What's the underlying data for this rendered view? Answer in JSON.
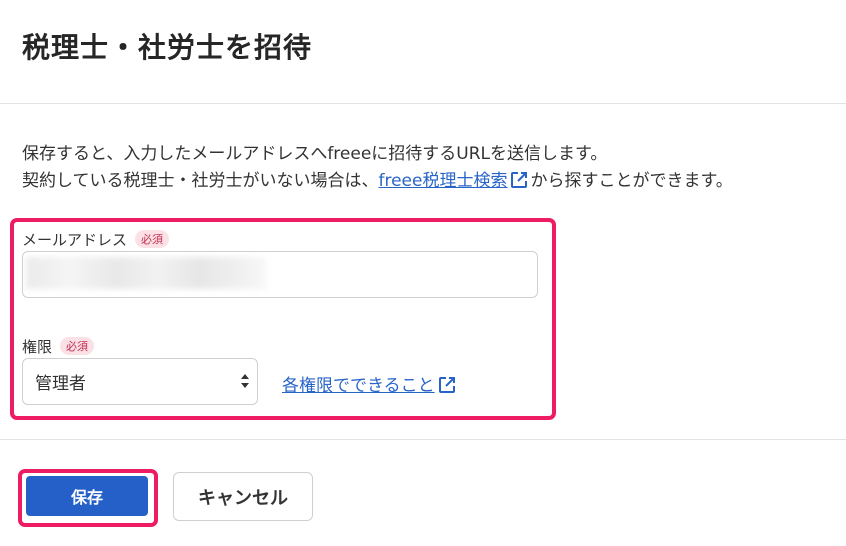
{
  "dialog": {
    "title": "税理士・社労士を招待"
  },
  "description": {
    "line1": "保存すると、入力したメールアドレスへfreeeに招待するURLを送信します。",
    "line2_before": "契約している税理士・社労士がいない場合は、",
    "line2_link": "freee税理士検索",
    "line2_after": "から探すことができます。"
  },
  "form": {
    "email": {
      "label": "メールアドレス",
      "required_badge": "必須",
      "value": ""
    },
    "role": {
      "label": "権限",
      "required_badge": "必須",
      "selected": "管理者",
      "help_link": "各権限でできること"
    }
  },
  "actions": {
    "save_label": "保存",
    "cancel_label": "キャンセル"
  },
  "colors": {
    "primary": "#2560c9",
    "link": "#2864c8",
    "highlight": "#ee1c63",
    "badge_bg": "#fbe1e6",
    "badge_text": "#c0304e"
  },
  "icons": {
    "external_link": "external-link-icon",
    "select_arrows": "sort-arrows-icon"
  }
}
